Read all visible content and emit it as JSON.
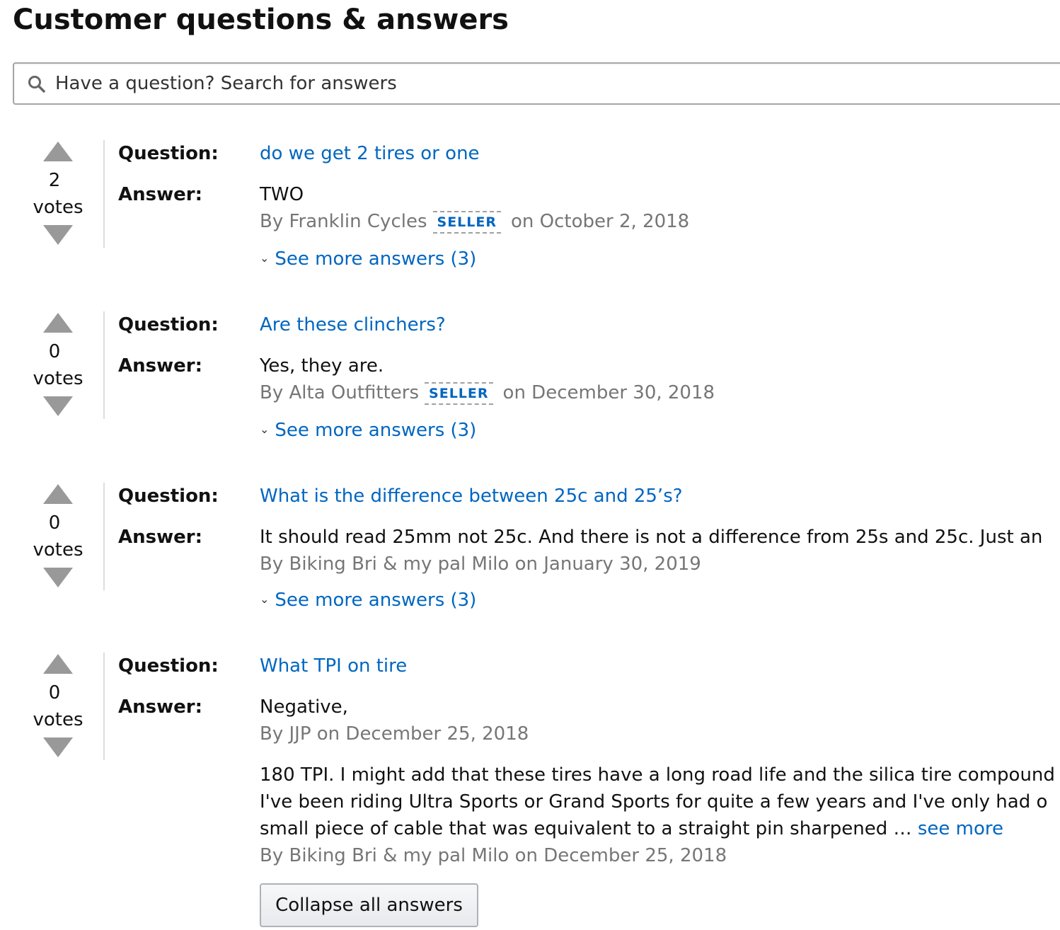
{
  "title": "Customer questions & answers",
  "search": {
    "placeholder": "Have a question? Search for answers"
  },
  "labels": {
    "question": "Question:",
    "answer": "Answer:",
    "votes": "votes",
    "seller_badge": "SELLER",
    "see_more": "see more",
    "collapse_all": "Collapse all answers"
  },
  "questions": [
    {
      "votes": "2",
      "question": "do we get 2 tires or one",
      "answer": "TWO",
      "by": "By Franklin Cycles",
      "date": "on October 2, 2018",
      "more_answers": "See more answers (3)"
    },
    {
      "votes": "0",
      "question": "Are these clinchers?",
      "answer": "Yes, they are.",
      "by": "By Alta Outfitters",
      "date": "on December 30, 2018",
      "more_answers": "See more answers (3)"
    },
    {
      "votes": "0",
      "question": "What is the difference between 25c and 25’s?",
      "answer": "It should read 25mm not 25c. And there is not a difference from 25s and 25c. Just an",
      "byline": "By Biking Bri & my pal Milo on January 30, 2019",
      "more_answers": "See more answers (3)"
    },
    {
      "votes": "0",
      "question": "What TPI on tire",
      "answer": "Negative,",
      "byline": "By JJP on December 25, 2018",
      "extra_answer_lines": [
        "180 TPI. I might add that these tires have a long road life and the silica tire compound",
        "I've been riding Ultra Sports or Grand Sports for quite a few years and I've only had o",
        "small piece of cable that was equivalent to a straight pin sharpened …"
      ],
      "extra_byline": "By Biking Bri & my pal Milo on December 25, 2018"
    }
  ]
}
